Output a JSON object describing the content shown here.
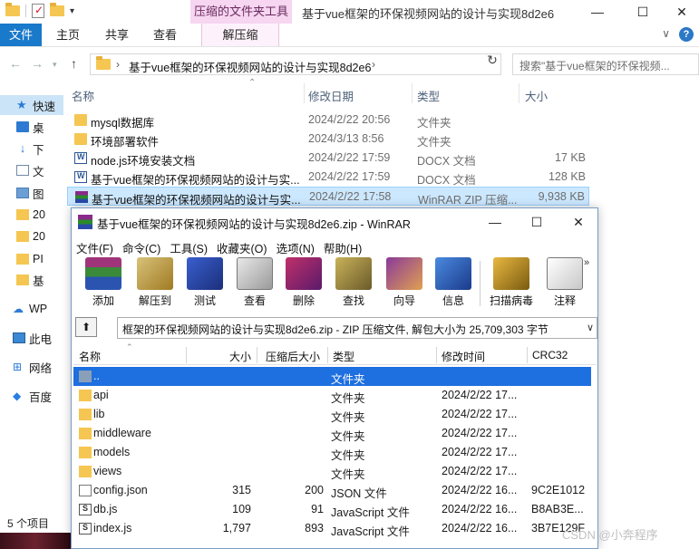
{
  "explorer": {
    "title": "基于vue框架的环保视频网站的设计与实现8d2e6",
    "context_tab_group": "压缩的文件夹工具",
    "window_buttons": {
      "minimize": "—",
      "maximize": "☐",
      "close": "✕"
    },
    "ribbon_tabs": [
      "文件",
      "主页",
      "共享",
      "查看",
      "解压缩"
    ],
    "address": {
      "path": "基于vue框架的环保视频网站的设计与实现8d2e6",
      "search_placeholder": "搜索\"基于vue框架的环保视频..."
    },
    "columns": {
      "name": "名称",
      "date": "修改日期",
      "type": "类型",
      "size": "大小"
    },
    "files": [
      {
        "name": "mysql数据库",
        "date": "2024/2/22 20:56",
        "type": "文件夹",
        "size": "",
        "icon": "folder-icon"
      },
      {
        "name": "环境部署软件",
        "date": "2024/3/13 8:56",
        "type": "文件夹",
        "size": "",
        "icon": "folder-icon"
      },
      {
        "name": "node.js环境安装文档",
        "date": "2024/2/22 17:59",
        "type": "DOCX 文档",
        "size": "17 KB",
        "icon": "docx-icon"
      },
      {
        "name": "基于vue框架的环保视频网站的设计与实...",
        "date": "2024/2/22 17:59",
        "type": "DOCX 文档",
        "size": "128 KB",
        "icon": "docx-icon"
      },
      {
        "name": "基于vue框架的环保视频网站的设计与实...",
        "date": "2024/2/22 17:58",
        "type": "WinRAR ZIP 压缩...",
        "size": "9,938 KB",
        "icon": "winrar-zip-icon",
        "selected": true
      }
    ],
    "nav_items": [
      {
        "label": "快速",
        "icon": "star-icon"
      },
      {
        "label": "桌",
        "icon": "desktop-icon"
      },
      {
        "label": "下",
        "icon": "download-icon"
      },
      {
        "label": "文",
        "icon": "document-icon"
      },
      {
        "label": "图",
        "icon": "picture-icon"
      },
      {
        "label": "20",
        "icon": "folder-icon"
      },
      {
        "label": "20",
        "icon": "folder-icon"
      },
      {
        "label": "PI",
        "icon": "folder-icon"
      },
      {
        "label": "基",
        "icon": "folder-icon"
      },
      {
        "label": "WP",
        "icon": "cloud-icon"
      },
      {
        "label": "此电",
        "icon": "pc-icon"
      },
      {
        "label": "网络",
        "icon": "network-icon"
      },
      {
        "label": "百度",
        "icon": "baidu-icon"
      }
    ],
    "status": "5 个项目"
  },
  "winrar": {
    "title": "基于vue框架的环保视频网站的设计与实现8d2e6.zip - WinRAR",
    "window_buttons": {
      "minimize": "—",
      "maximize": "☐",
      "close": "✕"
    },
    "menu": [
      "文件(F)",
      "命令(C)",
      "工具(S)",
      "收藏夹(O)",
      "选项(N)",
      "帮助(H)"
    ],
    "toolbar": [
      {
        "label": "添加",
        "icon": "add-archive-icon"
      },
      {
        "label": "解压到",
        "icon": "extract-to-icon"
      },
      {
        "label": "测试",
        "icon": "test-icon"
      },
      {
        "label": "查看",
        "icon": "view-icon"
      },
      {
        "label": "删除",
        "icon": "delete-icon"
      },
      {
        "label": "查找",
        "icon": "find-icon"
      },
      {
        "label": "向导",
        "icon": "wizard-icon"
      },
      {
        "label": "信息",
        "icon": "info-icon"
      },
      {
        "label": "扫描病毒",
        "icon": "virus-scan-icon"
      },
      {
        "label": "注释",
        "icon": "comment-icon"
      }
    ],
    "path_bar": "框架的环保视频网站的设计与实现8d2e6.zip - ZIP 压缩文件, 解包大小为 25,709,303 字节",
    "columns": {
      "name": "名称",
      "size": "大小",
      "packed": "压缩后大小",
      "type": "类型",
      "modified": "修改时间",
      "crc": "CRC32"
    },
    "files": [
      {
        "name": "..",
        "size": "",
        "packed": "",
        "type": "文件夹",
        "modified": "",
        "crc": "",
        "icon": "parent-folder-icon",
        "selected": true
      },
      {
        "name": "api",
        "size": "",
        "packed": "",
        "type": "文件夹",
        "modified": "2024/2/22 17...",
        "crc": "",
        "icon": "folder-icon"
      },
      {
        "name": "lib",
        "size": "",
        "packed": "",
        "type": "文件夹",
        "modified": "2024/2/22 17...",
        "crc": "",
        "icon": "folder-icon"
      },
      {
        "name": "middleware",
        "size": "",
        "packed": "",
        "type": "文件夹",
        "modified": "2024/2/22 17...",
        "crc": "",
        "icon": "folder-icon"
      },
      {
        "name": "models",
        "size": "",
        "packed": "",
        "type": "文件夹",
        "modified": "2024/2/22 17...",
        "crc": "",
        "icon": "folder-icon"
      },
      {
        "name": "views",
        "size": "",
        "packed": "",
        "type": "文件夹",
        "modified": "2024/2/22 17...",
        "crc": "",
        "icon": "folder-icon"
      },
      {
        "name": "config.json",
        "size": "315",
        "packed": "200",
        "type": "JSON 文件",
        "modified": "2024/2/22 16...",
        "crc": "9C2E1012",
        "icon": "json-file-icon"
      },
      {
        "name": "db.js",
        "size": "109",
        "packed": "91",
        "type": "JavaScript 文件",
        "modified": "2024/2/22 16...",
        "crc": "B8AB3E...",
        "icon": "js-file-icon"
      },
      {
        "name": "index.js",
        "size": "1,797",
        "packed": "893",
        "type": "JavaScript 文件",
        "modified": "2024/2/22 16...",
        "crc": "3B7E129F",
        "icon": "js-file-icon"
      }
    ]
  },
  "watermark": "CSDN @小奔程序"
}
